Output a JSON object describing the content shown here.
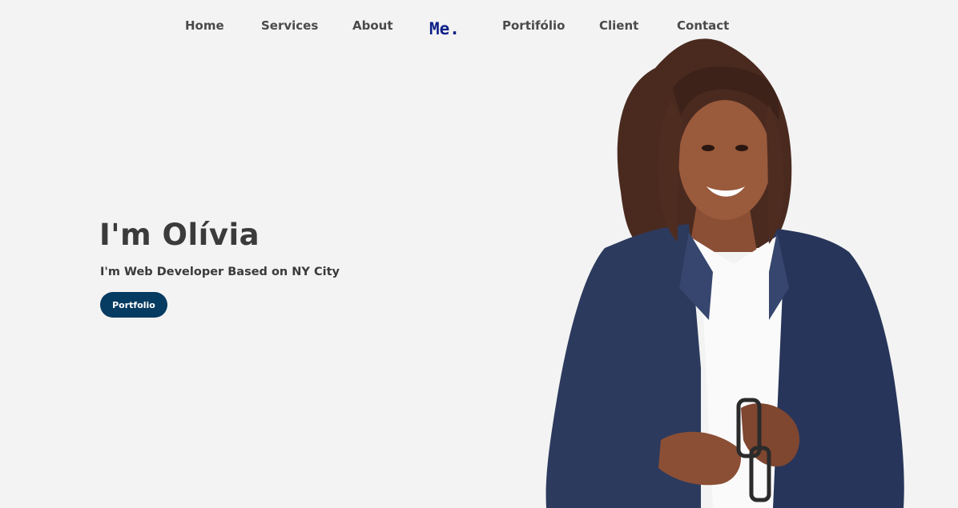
{
  "nav": {
    "links": [
      {
        "label": "Home"
      },
      {
        "label": "Services"
      },
      {
        "label": "About"
      },
      {
        "label": "Portifólio"
      },
      {
        "label": "Client"
      },
      {
        "label": "Contact"
      }
    ],
    "logo": "Me."
  },
  "hero": {
    "title": "I'm Olívia",
    "subtitle": "I'm Web Developer Based on NY City",
    "button_label": "Portfolio"
  },
  "colors": {
    "background": "#f3f3f3",
    "accent_button": "#063b62",
    "logo": "#0c1f87",
    "text": "#3a3a3a"
  },
  "portrait": {
    "icon": "person-portrait-image"
  }
}
